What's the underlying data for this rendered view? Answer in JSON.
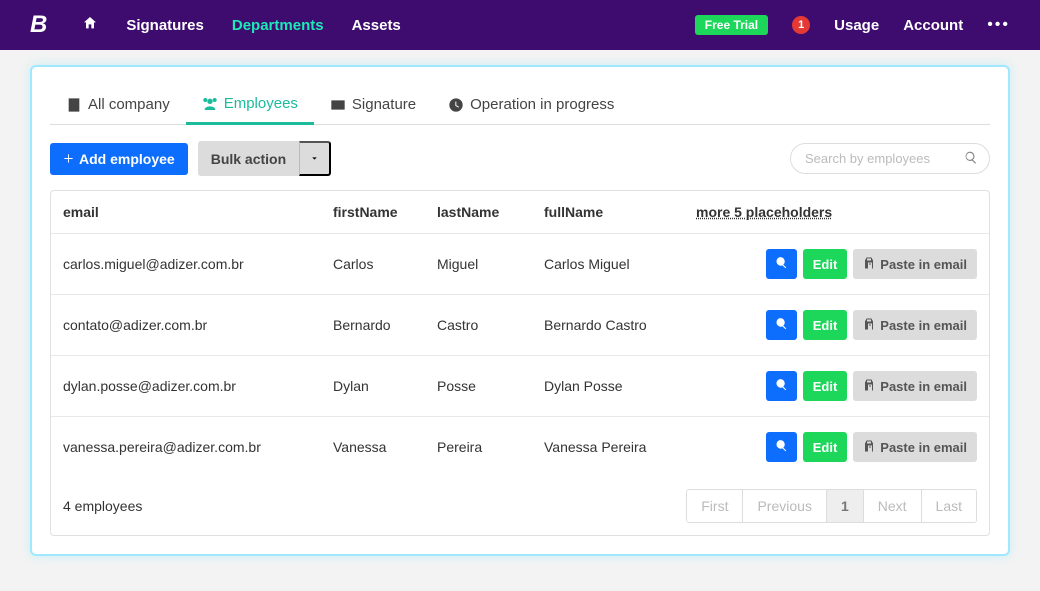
{
  "navbar": {
    "brand": "B",
    "items": [
      "Signatures",
      "Departments",
      "Assets"
    ],
    "activeIndex": 1,
    "freeTrial": "Free Trial",
    "notifCount": "1",
    "rightItems": [
      "Usage",
      "Account"
    ]
  },
  "tabs": [
    {
      "label": "All company"
    },
    {
      "label": "Employees"
    },
    {
      "label": "Signature"
    },
    {
      "label": "Operation in progress"
    }
  ],
  "activeTab": 1,
  "toolbar": {
    "addLabel": "Add employee",
    "bulkLabel": "Bulk action",
    "searchPlaceholder": "Search by employees"
  },
  "columns": {
    "email": "email",
    "first": "firstName",
    "last": "lastName",
    "full": "fullName",
    "more": "more 5 placeholders"
  },
  "actions": {
    "edit": "Edit",
    "paste": "Paste in email"
  },
  "rows": [
    {
      "email": "carlos.miguel@adizer.com.br",
      "first": "Carlos",
      "last": "Miguel",
      "full": "Carlos Miguel"
    },
    {
      "email": "contato@adizer.com.br",
      "first": "Bernardo",
      "last": "Castro",
      "full": "Bernardo Castro"
    },
    {
      "email": "dylan.posse@adizer.com.br",
      "first": "Dylan",
      "last": "Posse",
      "full": "Dylan Posse"
    },
    {
      "email": "vanessa.pereira@adizer.com.br",
      "first": "Vanessa",
      "last": "Pereira",
      "full": "Vanessa Pereira"
    }
  ],
  "footer": {
    "count": "4 employees",
    "first": "First",
    "prev": "Previous",
    "page": "1",
    "next": "Next",
    "last": "Last"
  }
}
